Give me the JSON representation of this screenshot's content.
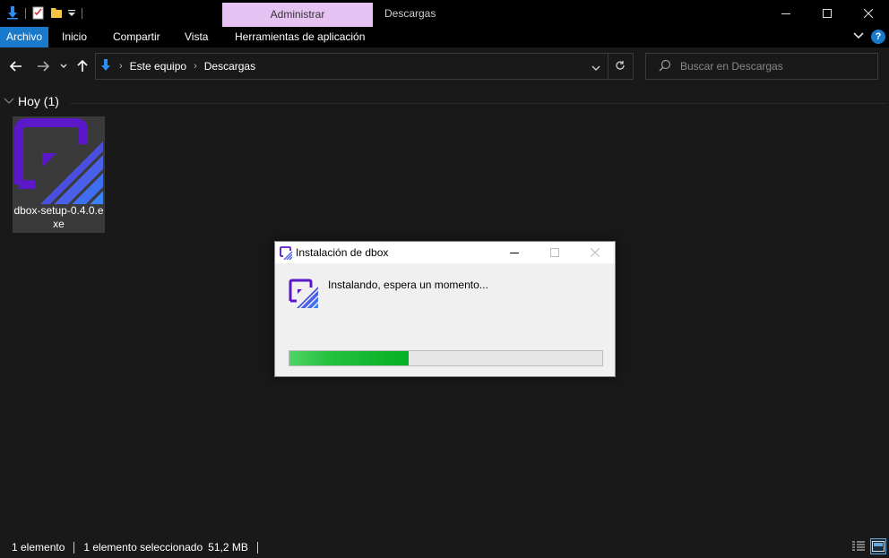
{
  "titlebar": {
    "contextual_tab": "Administrar",
    "window_title": "Descargas"
  },
  "ribbon": {
    "tabs": [
      "Archivo",
      "Inicio",
      "Compartir",
      "Vista",
      "Herramientas de aplicación"
    ]
  },
  "address": {
    "crumbs": [
      "Este equipo",
      "Descargas"
    ]
  },
  "search": {
    "placeholder": "Buscar en Descargas"
  },
  "content": {
    "group_label": "Hoy (1)",
    "file": {
      "name": "dbox-setup-0.4.0.exe"
    }
  },
  "dialog": {
    "title": "Instalación de dbox",
    "message": "Instalando, espera un momento...",
    "progress": 0.38
  },
  "status": {
    "count": "1 elemento",
    "selected": "1 elemento seleccionado",
    "size": "51,2 MB"
  },
  "colors": {
    "accent": "#1979ca",
    "contextual_tab": "#e6c3f3",
    "progress": "#06b025",
    "dbox_purple": "#5a18c8",
    "dbox_blue": "#3f6ef0"
  }
}
